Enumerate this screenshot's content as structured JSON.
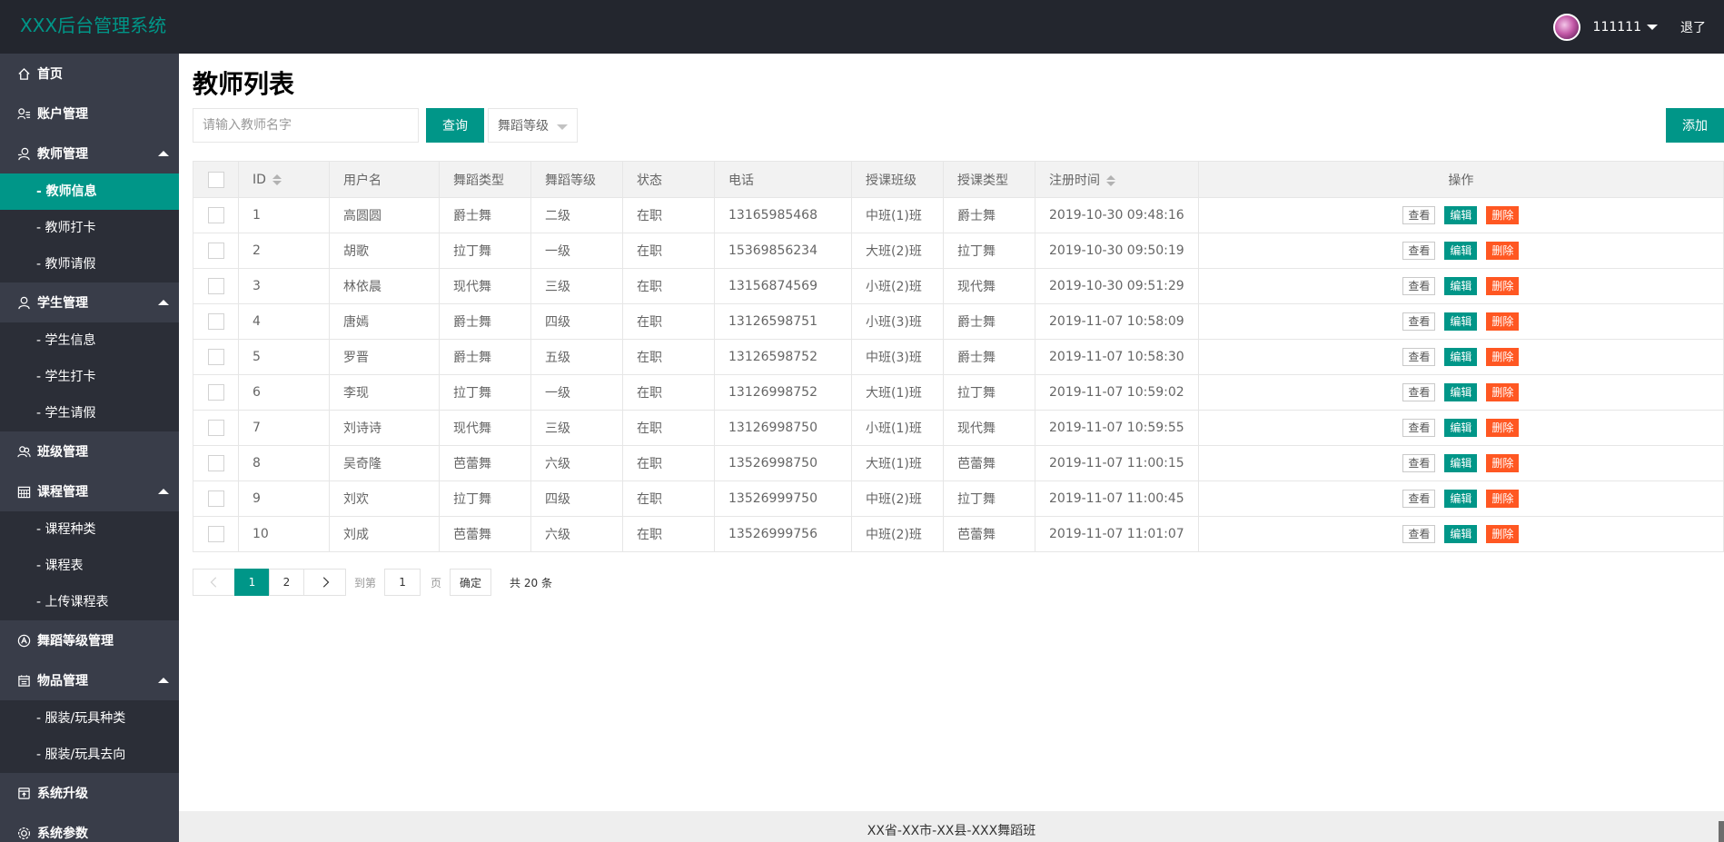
{
  "app": {
    "title": "XXX后台管理系统"
  },
  "header": {
    "username": "111111",
    "logout_label": "退了"
  },
  "sidebar": {
    "items": [
      {
        "label": "首页",
        "icon": "home-icon"
      },
      {
        "label": "账户管理",
        "icon": "user-list-icon"
      },
      {
        "label": "教师管理",
        "icon": "teacher-icon",
        "expanded": true,
        "children": [
          {
            "label": "- 教师信息",
            "active": true
          },
          {
            "label": "- 教师打卡"
          },
          {
            "label": "- 教师请假"
          }
        ]
      },
      {
        "label": "学生管理",
        "icon": "student-icon",
        "expanded": true,
        "children": [
          {
            "label": "- 学生信息"
          },
          {
            "label": "- 学生打卡"
          },
          {
            "label": "- 学生请假"
          }
        ]
      },
      {
        "label": "班级管理",
        "icon": "group-icon"
      },
      {
        "label": "课程管理",
        "icon": "calendar-icon",
        "expanded": true,
        "children": [
          {
            "label": "- 课程种类"
          },
          {
            "label": "- 课程表"
          },
          {
            "label": "- 上传课程表"
          }
        ]
      },
      {
        "label": "舞蹈等级管理",
        "icon": "level-icon"
      },
      {
        "label": "物品管理",
        "icon": "goods-icon",
        "expanded": true,
        "children": [
          {
            "label": "- 服装/玩具种类"
          },
          {
            "label": "- 服装/玩具去向"
          }
        ]
      },
      {
        "label": "系统升级",
        "icon": "upgrade-icon"
      },
      {
        "label": "系统参数",
        "icon": "settings-icon"
      }
    ]
  },
  "main": {
    "title": "教师列表",
    "search": {
      "placeholder": "请输入教师名字",
      "value": ""
    },
    "query_label": "查询",
    "level_select_label": "舞蹈等级",
    "add_label": "添加"
  },
  "table": {
    "columns": [
      "ID",
      "用户名",
      "舞蹈类型",
      "舞蹈等级",
      "状态",
      "电话",
      "授课班级",
      "授课类型",
      "注册时间",
      "操作"
    ],
    "actions": {
      "view": "查看",
      "edit": "编辑",
      "delete": "删除"
    },
    "rows": [
      [
        "1",
        "高圆圆",
        "爵士舞",
        "二级",
        "在职",
        "13165985468",
        "中班(1)班",
        "爵士舞",
        "2019-10-30 09:48:16"
      ],
      [
        "2",
        "胡歌",
        "拉丁舞",
        "一级",
        "在职",
        "15369856234",
        "大班(2)班",
        "拉丁舞",
        "2019-10-30 09:50:19"
      ],
      [
        "3",
        "林依晨",
        "现代舞",
        "三级",
        "在职",
        "13156874569",
        "小班(2)班",
        "现代舞",
        "2019-10-30 09:51:29"
      ],
      [
        "4",
        "唐嫣",
        "爵士舞",
        "四级",
        "在职",
        "13126598751",
        "小班(3)班",
        "爵士舞",
        "2019-11-07 10:58:09"
      ],
      [
        "5",
        "罗晋",
        "爵士舞",
        "五级",
        "在职",
        "13126598752",
        "中班(3)班",
        "爵士舞",
        "2019-11-07 10:58:30"
      ],
      [
        "6",
        "李现",
        "拉丁舞",
        "一级",
        "在职",
        "13126998752",
        "大班(1)班",
        "拉丁舞",
        "2019-11-07 10:59:02"
      ],
      [
        "7",
        "刘诗诗",
        "现代舞",
        "三级",
        "在职",
        "13126998750",
        "小班(1)班",
        "现代舞",
        "2019-11-07 10:59:55"
      ],
      [
        "8",
        "吴奇隆",
        "芭蕾舞",
        "六级",
        "在职",
        "13526998750",
        "大班(1)班",
        "芭蕾舞",
        "2019-11-07 11:00:15"
      ],
      [
        "9",
        "刘欢",
        "拉丁舞",
        "四级",
        "在职",
        "13526999750",
        "中班(2)班",
        "拉丁舞",
        "2019-11-07 11:00:45"
      ],
      [
        "10",
        "刘成",
        "芭蕾舞",
        "六级",
        "在职",
        "13526999756",
        "中班(2)班",
        "芭蕾舞",
        "2019-11-07 11:01:07"
      ]
    ]
  },
  "pagination": {
    "pages": [
      "1",
      "2"
    ],
    "current": "1",
    "goto_label": "到第",
    "goto_value": "1",
    "page_label": "页",
    "confirm_label": "确定",
    "total_label": "共 20 条"
  },
  "footer": {
    "text": "XX省-XX市-XX县-XXX舞蹈班"
  },
  "colors": {
    "accent": "#009688",
    "danger": "#ff5722",
    "header_bg": "#23262e",
    "sidebar_bg": "#393d49",
    "sidebar_sub_bg": "#2b2e37"
  }
}
